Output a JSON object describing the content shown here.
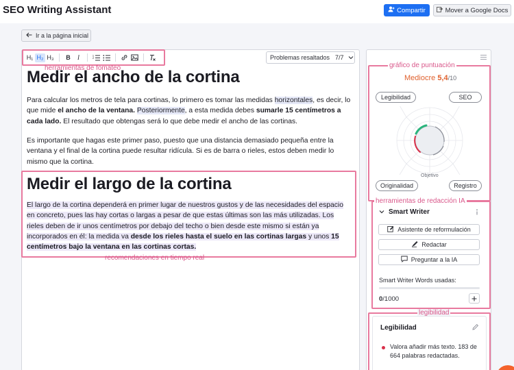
{
  "app": {
    "title": "SEO Writing Assistant"
  },
  "header": {
    "share_label": "Compartir",
    "gdocs_label": "Mover a Google Docs"
  },
  "nav": {
    "back_label": "Ir a la página inicial"
  },
  "toolbar": {
    "h1": "H₁",
    "h2": "H₂",
    "h3": "H₃",
    "bold": "B",
    "italic": "I",
    "annotation": "herramientas de fomateo"
  },
  "issues": {
    "label": "Problemas resaltados",
    "count": "7/7"
  },
  "document": {
    "heading1": "Medir el ancho de la cortina",
    "p1": {
      "a": "Para calcular los metros de tela para cortinas, lo primero es tomar las medidas ",
      "b": "horizontales",
      "c": ", es decir, lo que mide ",
      "d": "el ancho de la ventana.",
      "e": " ",
      "f": "Posteriormente",
      "g": ", a esta medida debes ",
      "h": "sumarle 15 centímetros a cada lado.",
      "i": " El resultado que obtengas será lo que debe medir el ancho de las cortinas."
    },
    "p2": "Es importante que hagas este primer paso, puesto que una distancia demasiado pequeña entre la ventana y el final de la cortina puede resultar ridícula. Si es de barra o rieles, estos deben medir lo mismo que la cortina.",
    "heading2": "Medir el largo de la cortina",
    "p3": {
      "a": "El largo de la cortina dependerá en primer lugar de nuestros gustos y de las necesidades del espacio en concreto, pues las hay cortas o largas a pesar de que estas últimas son las más utilizadas. Los rieles deben de ir unos centímetros por debajo del techo o bien desde este mismo si están ya incorporados en él: la medida va ",
      "b": "desde los rieles hasta el suelo en las cortinas largas",
      "c": " y unos ",
      "d": "15 centímetros bajo la ventana en las cortinas cortas."
    },
    "recommend_annotation": "recomendaciones en tiempo real"
  },
  "sidebar": {
    "score_annotation": "gráfico de puntuación",
    "score_word": "Mediocre",
    "score_value": "5,4",
    "score_max": "/10",
    "score_fraction": 0.54,
    "pills": {
      "readability": "Legibilidad",
      "seo": "SEO",
      "originality": "Originalidad",
      "tone": "Registro"
    },
    "target_label": "Objetivo",
    "ai_annotation": "herramientas de redacción IA",
    "smart_writer": {
      "title": "Smart Writer",
      "rephrase_label": "Asistente de reformulación",
      "compose_label": "Redactar",
      "ask_label": "Preguntar a la IA",
      "words_label": "Smart Writer Words usadas:",
      "words_used": "0",
      "words_total": "/1000",
      "words_fraction": 0
    },
    "readability_annotation": "legibilidad",
    "readability": {
      "title": "Legibilidad",
      "tip": "Valora añadir más texto. 183 de 664 palabras redactadas."
    }
  },
  "colors": {
    "accent": "#1d6ff2",
    "annotation": "#e8799e",
    "score": "#e0622f",
    "warning_dot": "#d9304a"
  }
}
